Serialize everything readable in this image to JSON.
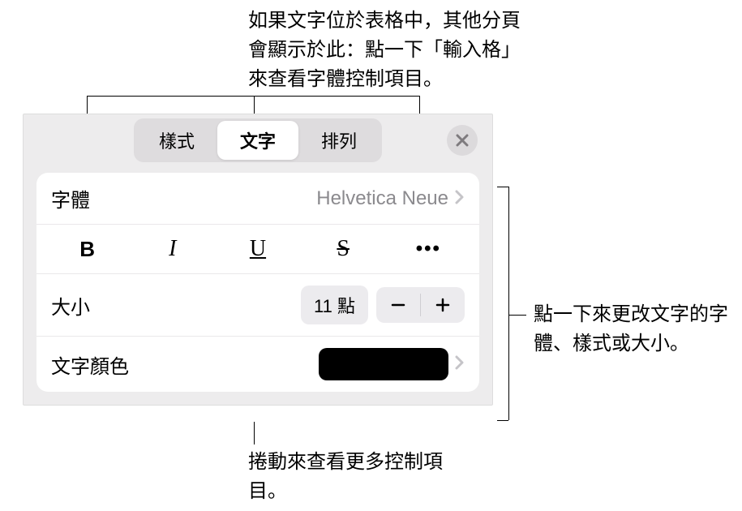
{
  "annotations": {
    "top": "如果文字位於表格中，其他分頁會顯示於此：點一下「輸入格」來查看字體控制項目。",
    "right": "點一下來更改文字的字體、樣式或大小。",
    "bottom": "捲動來查看更多控制項目。"
  },
  "header": {
    "tabs": [
      {
        "label": "樣式",
        "active": false
      },
      {
        "label": "文字",
        "active": true
      },
      {
        "label": "排列",
        "active": false
      }
    ]
  },
  "font_row": {
    "label": "字體",
    "value": "Helvetica Neue"
  },
  "style_row": {
    "bold": "B",
    "italic": "I",
    "underline": "U",
    "strike": "S",
    "more": "•••"
  },
  "size_row": {
    "label": "大小",
    "value": "11 點"
  },
  "color_row": {
    "label": "文字顏色",
    "color": "#000000"
  }
}
